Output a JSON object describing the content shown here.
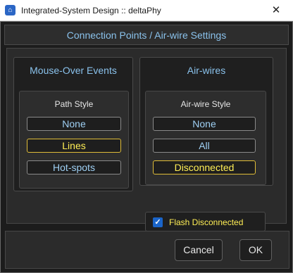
{
  "window": {
    "title": "Integrated-System Design :: deltaPhy",
    "app_icon": "app-logo-icon",
    "close_glyph": "✕"
  },
  "header": {
    "title": "Connection Points / Air-wire Settings"
  },
  "mouse_over": {
    "title": "Mouse-Over Events",
    "sub_label": "Path Style",
    "options": [
      "None",
      "Lines",
      "Hot-spots"
    ],
    "selected": "Lines"
  },
  "air_wires": {
    "title": "Air-wires",
    "sub_label": "Air-wire Style",
    "options": [
      "None",
      "All",
      "Disconnected"
    ],
    "selected": "Disconnected"
  },
  "flash": {
    "label": "Flash Disconnected",
    "checked": true,
    "check_glyph": "✓"
  },
  "footer": {
    "cancel_label": "Cancel",
    "ok_label": "OK"
  },
  "colors": {
    "accent_text": "#8ac2ec",
    "selected_text": "#ffee55",
    "selected_border": "#e0bd38",
    "background": "#1c1c1c"
  }
}
